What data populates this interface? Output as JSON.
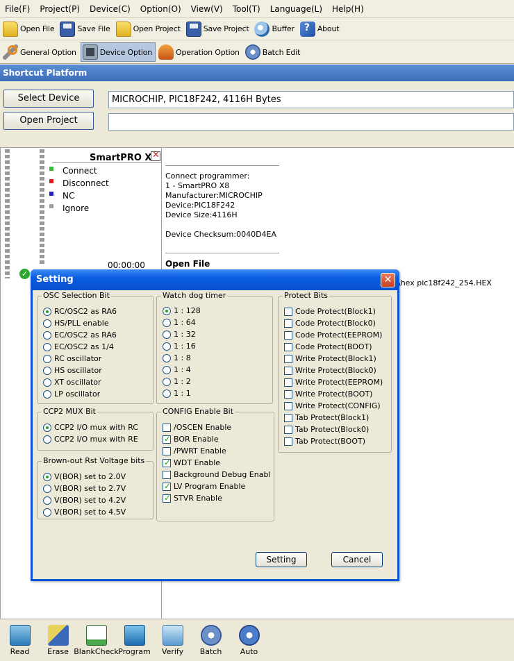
{
  "menu": [
    "File(F)",
    "Project(P)",
    "Device(C)",
    "Option(O)",
    "View(V)",
    "Tool(T)",
    "Language(L)",
    "Help(H)"
  ],
  "toolbar1": [
    {
      "label": "Open File",
      "icon": "folder-open-icon"
    },
    {
      "label": "Save File",
      "icon": "floppy-disk-icon"
    },
    {
      "label": "Open Project",
      "icon": "folder-project-icon"
    },
    {
      "label": "Save Project",
      "icon": "save-project-icon"
    },
    {
      "label": "Buffer",
      "icon": "magnifier-icon"
    },
    {
      "label": "About",
      "icon": "help-icon"
    }
  ],
  "toolbar2": [
    {
      "label": "General Option",
      "icon": "wrench-icon",
      "active": false
    },
    {
      "label": "Device Option",
      "icon": "chip-icon",
      "active": true
    },
    {
      "label": "Operation Option",
      "icon": "operation-icon",
      "active": false
    },
    {
      "label": "Batch Edit",
      "icon": "gear-icon",
      "active": false
    }
  ],
  "shortcut_platform": {
    "title": "Shortcut Platform"
  },
  "select": {
    "select_device_label": "Select Device",
    "open_project_label": "Open Project",
    "device_value": "MICROCHIP, PIC18F242, 4116H Bytes",
    "project_value": ""
  },
  "programmer": {
    "name": "SmartPRO X8",
    "legend": [
      {
        "label": "Connect",
        "color": "#3cb93c"
      },
      {
        "label": "Disconnect",
        "color": "#e02020"
      },
      {
        "label": "NC",
        "color": "#2020d0"
      },
      {
        "label": "Ignore",
        "color": "#a0a0a0"
      }
    ],
    "timer": "00:00:00"
  },
  "log": {
    "lines": "Connect programmer:\n1 - SmartPRO X8\nManufacturer:MICROCHIP\nDevice:PIC18F242\nDevice Size:4116H\n\nDevice Checksum:0040D4EA",
    "section": "Open File",
    "path_fragment": "\\hex pic18f242_254.HEX"
  },
  "dialog": {
    "title": "Setting",
    "osc": {
      "title": "OSC Selection Bit",
      "options": [
        {
          "label": "RC/OSC2 as RA6",
          "checked": true
        },
        {
          "label": "HS/PLL enable",
          "checked": false
        },
        {
          "label": "EC/OSC2 as RA6",
          "checked": false
        },
        {
          "label": "EC/OSC2 as 1/4",
          "checked": false
        },
        {
          "label": "RC oscillator",
          "checked": false
        },
        {
          "label": "HS oscillator",
          "checked": false
        },
        {
          "label": "XT oscillator",
          "checked": false
        },
        {
          "label": "LP oscillator",
          "checked": false
        }
      ]
    },
    "wdt": {
      "title": "Watch dog timer",
      "options": [
        {
          "label": "1 : 128",
          "checked": true
        },
        {
          "label": "1 : 64",
          "checked": false
        },
        {
          "label": "1 : 32",
          "checked": false
        },
        {
          "label": "1 : 16",
          "checked": false
        },
        {
          "label": "1 : 8",
          "checked": false
        },
        {
          "label": "1 : 4",
          "checked": false
        },
        {
          "label": "1 : 2",
          "checked": false
        },
        {
          "label": "1 : 1",
          "checked": false
        }
      ]
    },
    "protect": {
      "title": "Protect Bits",
      "options": [
        {
          "label": "Code Protect(Block1)",
          "checked": false
        },
        {
          "label": "Code Protect(Block0)",
          "checked": false
        },
        {
          "label": "Code Protect(EEPROM)",
          "checked": false
        },
        {
          "label": "Code Protect(BOOT)",
          "checked": false
        },
        {
          "label": "Write Protect(Block1)",
          "checked": false
        },
        {
          "label": "Write Protect(Block0)",
          "checked": false
        },
        {
          "label": "Write Protect(EEPROM)",
          "checked": false
        },
        {
          "label": "Write Protect(BOOT)",
          "checked": false
        },
        {
          "label": "Write Protect(CONFIG)",
          "checked": false
        },
        {
          "label": "Tab Protect(Block1)",
          "checked": false
        },
        {
          "label": "Tab Protect(Block0)",
          "checked": false
        },
        {
          "label": "Tab Protect(BOOT)",
          "checked": false
        }
      ]
    },
    "ccp2": {
      "title": "CCP2 MUX Bit",
      "options": [
        {
          "label": "CCP2 I/O mux with RC",
          "checked": true
        },
        {
          "label": "CCP2 I/O mux with RE",
          "checked": false
        }
      ]
    },
    "config": {
      "title": "CONFIG Enable Bit",
      "options": [
        {
          "label": "/OSCEN Enable",
          "checked": false
        },
        {
          "label": "BOR Enable",
          "checked": true
        },
        {
          "label": "/PWRT Enable",
          "checked": false
        },
        {
          "label": "WDT Enable",
          "checked": true
        },
        {
          "label": "Background Debug Enabl",
          "checked": false
        },
        {
          "label": "LV Program Enable",
          "checked": true
        },
        {
          "label": "STVR Enable",
          "checked": true
        }
      ]
    },
    "bor": {
      "title": "Brown-out Rst Voltage bits",
      "options": [
        {
          "label": "V(BOR) set to 2.0V",
          "checked": true
        },
        {
          "label": "V(BOR) set to 2.7V",
          "checked": false
        },
        {
          "label": "V(BOR) set to 4.2V",
          "checked": false
        },
        {
          "label": "V(BOR) set to 4.5V",
          "checked": false
        }
      ]
    },
    "setting_label": "Setting",
    "cancel_label": "Cancel"
  },
  "bottom": [
    {
      "label": "Read",
      "icon": "read-icon"
    },
    {
      "label": "Erase",
      "icon": "erase-icon"
    },
    {
      "label": "BlankCheck",
      "icon": "blank-check-icon"
    },
    {
      "label": "Program",
      "icon": "program-icon"
    },
    {
      "label": "Verify",
      "icon": "verify-icon"
    },
    {
      "label": "Batch",
      "icon": "batch-icon"
    },
    {
      "label": "Auto",
      "icon": "auto-icon"
    }
  ]
}
